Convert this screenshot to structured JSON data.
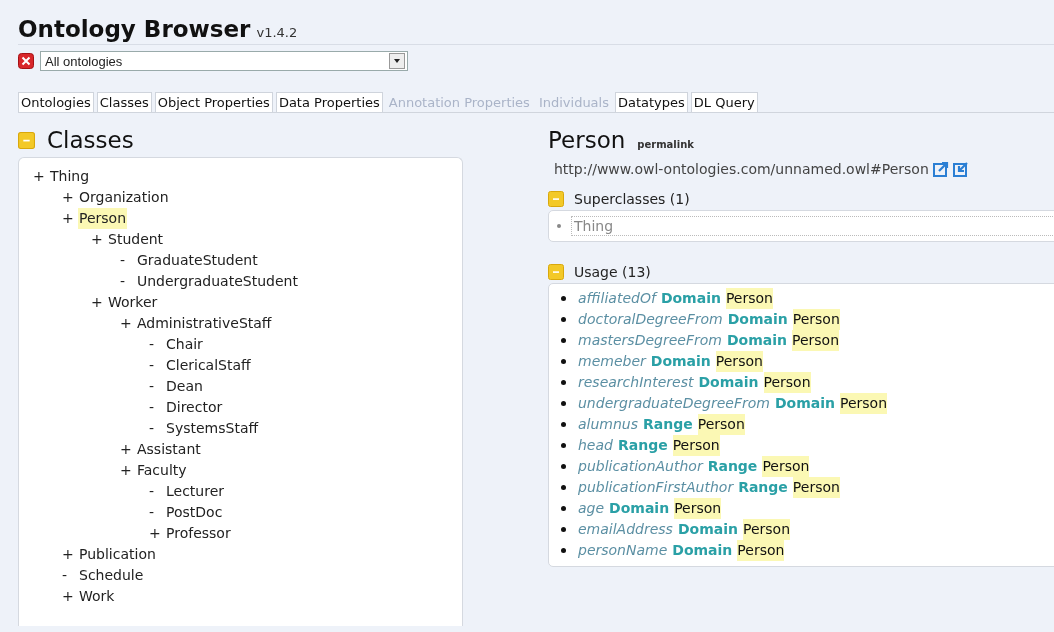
{
  "header": {
    "title": "Ontology Browser",
    "version": "v1.4.2"
  },
  "ontology_select": {
    "value": "All ontologies"
  },
  "tabs": [
    {
      "label": "Ontologies",
      "disabled": false
    },
    {
      "label": "Classes",
      "disabled": false
    },
    {
      "label": "Object Properties",
      "disabled": false
    },
    {
      "label": "Data Properties",
      "disabled": false
    },
    {
      "label": "Annotation Properties",
      "disabled": true
    },
    {
      "label": "Individuals",
      "disabled": true
    },
    {
      "label": "Datatypes",
      "disabled": false
    },
    {
      "label": "DL Query",
      "disabled": false
    }
  ],
  "classes_panel": {
    "title": "Classes",
    "tree": [
      {
        "marker": "+",
        "label": "Thing",
        "selected": false,
        "children": [
          {
            "marker": "+",
            "label": "Organization",
            "selected": false
          },
          {
            "marker": "+",
            "label": "Person",
            "selected": true,
            "children": [
              {
                "marker": "+",
                "label": "Student",
                "selected": false,
                "children": [
                  {
                    "marker": "-",
                    "label": "GraduateStudent",
                    "selected": false
                  },
                  {
                    "marker": "-",
                    "label": "UndergraduateStudent",
                    "selected": false
                  }
                ]
              },
              {
                "marker": "+",
                "label": "Worker",
                "selected": false,
                "children": [
                  {
                    "marker": "+",
                    "label": "AdministrativeStaff",
                    "selected": false,
                    "children": [
                      {
                        "marker": "-",
                        "label": "Chair",
                        "selected": false
                      },
                      {
                        "marker": "-",
                        "label": "ClericalStaff",
                        "selected": false
                      },
                      {
                        "marker": "-",
                        "label": "Dean",
                        "selected": false
                      },
                      {
                        "marker": "-",
                        "label": "Director",
                        "selected": false
                      },
                      {
                        "marker": "-",
                        "label": "SystemsStaff",
                        "selected": false
                      }
                    ]
                  },
                  {
                    "marker": "+",
                    "label": "Assistant",
                    "selected": false
                  },
                  {
                    "marker": "+",
                    "label": "Faculty",
                    "selected": false,
                    "children": [
                      {
                        "marker": "-",
                        "label": "Lecturer",
                        "selected": false
                      },
                      {
                        "marker": "-",
                        "label": "PostDoc",
                        "selected": false
                      },
                      {
                        "marker": "+",
                        "label": "Professor",
                        "selected": false
                      }
                    ]
                  }
                ]
              }
            ]
          },
          {
            "marker": "+",
            "label": "Publication",
            "selected": false
          },
          {
            "marker": "-",
            "label": "Schedule",
            "selected": false
          },
          {
            "marker": "+",
            "label": "Work",
            "selected": false
          }
        ]
      }
    ]
  },
  "detail": {
    "title": "Person",
    "permalink": "permalink",
    "iri": "http://www.owl-ontologies.com/unnamed.owl#Person",
    "superclasses": {
      "title": "Superclasses (1)",
      "items": [
        "Thing"
      ]
    },
    "usage": {
      "title": "Usage (13)",
      "items": [
        {
          "property": "affiliatedOf",
          "relation": "Domain",
          "target": "Person"
        },
        {
          "property": "doctoralDegreeFrom",
          "relation": "Domain",
          "target": "Person"
        },
        {
          "property": "mastersDegreeFrom",
          "relation": "Domain",
          "target": "Person"
        },
        {
          "property": "memeber",
          "relation": "Domain",
          "target": "Person"
        },
        {
          "property": "researchInterest",
          "relation": "Domain",
          "target": "Person"
        },
        {
          "property": "undergraduateDegreeFrom",
          "relation": "Domain",
          "target": "Person"
        },
        {
          "property": "alumnus",
          "relation": "Range",
          "target": "Person"
        },
        {
          "property": "head",
          "relation": "Range",
          "target": "Person"
        },
        {
          "property": "publicationAuthor",
          "relation": "Range",
          "target": "Person"
        },
        {
          "property": "publicationFirstAuthor",
          "relation": "Range",
          "target": "Person"
        },
        {
          "property": "age",
          "relation": "Domain",
          "target": "Person"
        },
        {
          "property": "emailAddress",
          "relation": "Domain",
          "target": "Person"
        },
        {
          "property": "personName",
          "relation": "Domain",
          "target": "Person"
        }
      ]
    }
  }
}
